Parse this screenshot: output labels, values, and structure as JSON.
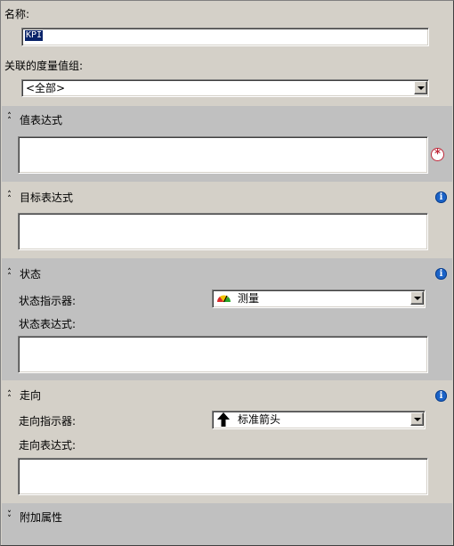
{
  "name_label": "名称:",
  "name_value": "KPI",
  "measure_group": {
    "label": "关联的度量值组:",
    "selected": "<全部>"
  },
  "sections": {
    "value": {
      "title": "值表达式"
    },
    "goal": {
      "title": "目标表达式"
    },
    "status": {
      "title": "状态",
      "indicator_label": "状态指示器:",
      "indicator_value": "测量",
      "expression_label": "状态表达式:"
    },
    "trend": {
      "title": "走向",
      "indicator_label": "走向指示器:",
      "indicator_value": "标准箭头",
      "expression_label": "走向表达式:"
    },
    "additional": {
      "title": "附加属性"
    }
  },
  "icons": {
    "collapse": "double-chevron-up-icon",
    "expand": "double-chevron-down-icon",
    "info": "info-icon",
    "required": "required-asterisk-icon",
    "gauge": "gauge-icon",
    "arrow": "arrow-up-icon"
  },
  "colors": {
    "panel": "#d4d0c8",
    "section_dark": "#c0c0c0",
    "selection": "#0a246a",
    "info_blue": "#1b63c8",
    "required_red": "#c0283a"
  }
}
